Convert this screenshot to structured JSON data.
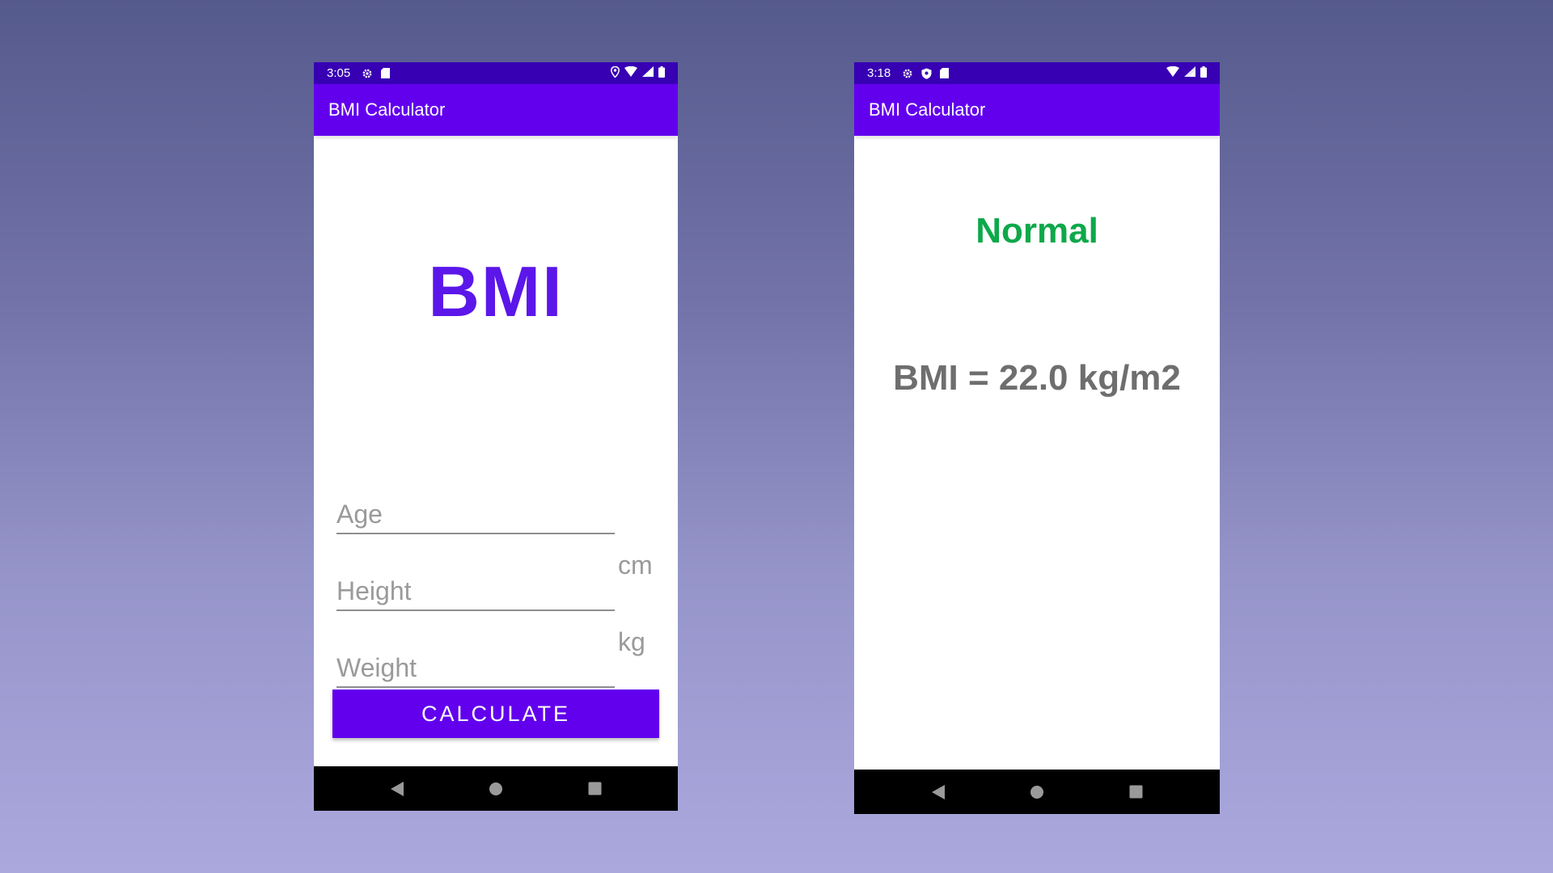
{
  "colors": {
    "status_bar": "#3700b3",
    "app_bar": "#6200ee",
    "logo": "#5b16ea",
    "normal_category": "#0ea84a",
    "result_text": "#6e6e6e"
  },
  "left_screen": {
    "status_bar": {
      "time": "3:05",
      "left_icons": [
        "gear-icon",
        "sd-card-icon"
      ],
      "right_icons": [
        "location-icon",
        "wifi-icon",
        "signal-icon",
        "battery-icon"
      ]
    },
    "app_bar": {
      "title": "BMI Calculator"
    },
    "logo_text": "BMI",
    "fields": {
      "age": {
        "placeholder": "Age"
      },
      "height": {
        "placeholder": "Height",
        "unit": "cm"
      },
      "weight": {
        "placeholder": "Weight",
        "unit": "kg"
      }
    },
    "calculate_button": {
      "label": "CALCULATE"
    },
    "nav_bar": {
      "icons": [
        "back-icon",
        "home-icon",
        "recents-icon"
      ]
    }
  },
  "right_screen": {
    "status_bar": {
      "time": "3:18",
      "left_icons": [
        "gear-icon",
        "shield-icon",
        "sd-card-icon"
      ],
      "right_icons": [
        "wifi-icon",
        "signal-icon",
        "battery-icon"
      ]
    },
    "app_bar": {
      "title": "BMI Calculator"
    },
    "result": {
      "category": "Normal",
      "value_text": "BMI = 22.0 kg/m2"
    },
    "nav_bar": {
      "icons": [
        "back-icon",
        "home-icon",
        "recents-icon"
      ]
    }
  }
}
